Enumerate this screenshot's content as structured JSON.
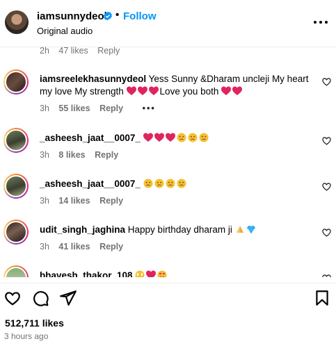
{
  "header": {
    "username": "iamsunnydeol",
    "separator": "•",
    "follow_label": "Follow",
    "subtitle": "Original audio"
  },
  "partial_top": {
    "time": "2h",
    "likes": "47 likes",
    "reply": "Reply"
  },
  "comments": [
    {
      "username": "iamsreelekhasunnydeol",
      "text_1": "Yess Sunny &Dharam uncleji My heart my love My strength ",
      "text_2": "Love you both ",
      "time": "3h",
      "likes": "55 likes",
      "reply": "Reply",
      "more": "•••"
    },
    {
      "username": "_asheesh_jaat__0007_",
      "time": "3h",
      "likes": "8 likes",
      "reply": "Reply"
    },
    {
      "username": "_asheesh_jaat__0007_",
      "time": "3h",
      "likes": "14 likes",
      "reply": "Reply"
    },
    {
      "username": "udit_singh_jaghina",
      "text_1": "Happy birthday dharam ji",
      "time": "3h",
      "likes": "41 likes",
      "reply": "Reply"
    },
    {
      "username": "bhavesh_thakor_108"
    }
  ],
  "footer": {
    "likes_total": "512,711 likes",
    "timestamp": "3 hours ago"
  },
  "colors": {
    "accent": "#0095f6",
    "muted": "#737373",
    "heart": "#ed4956"
  },
  "icons": [
    "verified-badge-icon",
    "more-options-icon",
    "heart-icon",
    "comment-icon",
    "share-icon",
    "bookmark-icon",
    "red-heart-emoji",
    "sad-face-emoji",
    "folded-hands-emoji",
    "gem-emoji"
  ]
}
